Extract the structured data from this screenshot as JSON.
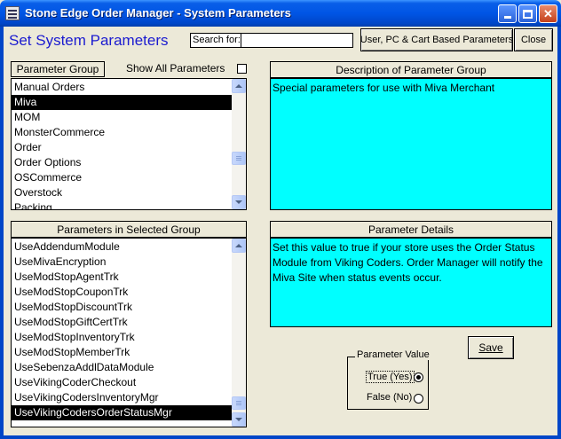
{
  "window": {
    "title": "Stone Edge Order Manager - System Parameters"
  },
  "header": {
    "title": "Set System Parameters",
    "search_label": "Search for:",
    "search_value": "",
    "user_params_button": "User, PC & Cart Based Parameters",
    "close_button": "Close"
  },
  "groups": {
    "header": "Parameter Group",
    "show_all_label": "Show All Parameters",
    "show_all_checked": false,
    "items": [
      "Manual Orders",
      "Miva",
      "MOM",
      "MonsterCommerce",
      "Order",
      "Order Options",
      "OSCommerce",
      "Overstock",
      "Packing"
    ],
    "selected": "Miva"
  },
  "description": {
    "header": "Description of Parameter Group",
    "text": "Special parameters for use with Miva Merchant"
  },
  "parameters": {
    "header": "Parameters in Selected Group",
    "items": [
      "UseAddendumModule",
      "UseMivaEncryption",
      "UseModStopAgentTrk",
      "UseModStopCouponTrk",
      "UseModStopDiscountTrk",
      "UseModStopGiftCertTrk",
      "UseModStopInventoryTrk",
      "UseModStopMemberTrk",
      "UseSebenzaAddlDataModule",
      "UseVikingCoderCheckout",
      "UseVikingCodersInventoryMgr",
      "UseVikingCodersOrderStatusMgr"
    ],
    "selected": "UseVikingCodersOrderStatusMgr"
  },
  "details": {
    "header": "Parameter Details",
    "text": "Set this value to true if your store uses the Order Status Module from Viking Coders. Order Manager will notify the Miva Site when status events occur."
  },
  "value": {
    "legend": "Parameter Value",
    "true_label": "True (Yes)",
    "false_label": "False (No)",
    "selected": "true"
  },
  "save_button": "Save",
  "colors": {
    "title_bar": "#0055e5",
    "highlight_panel": "#00ffff",
    "heading_text": "#1b1bd0",
    "selection": "#000000"
  }
}
